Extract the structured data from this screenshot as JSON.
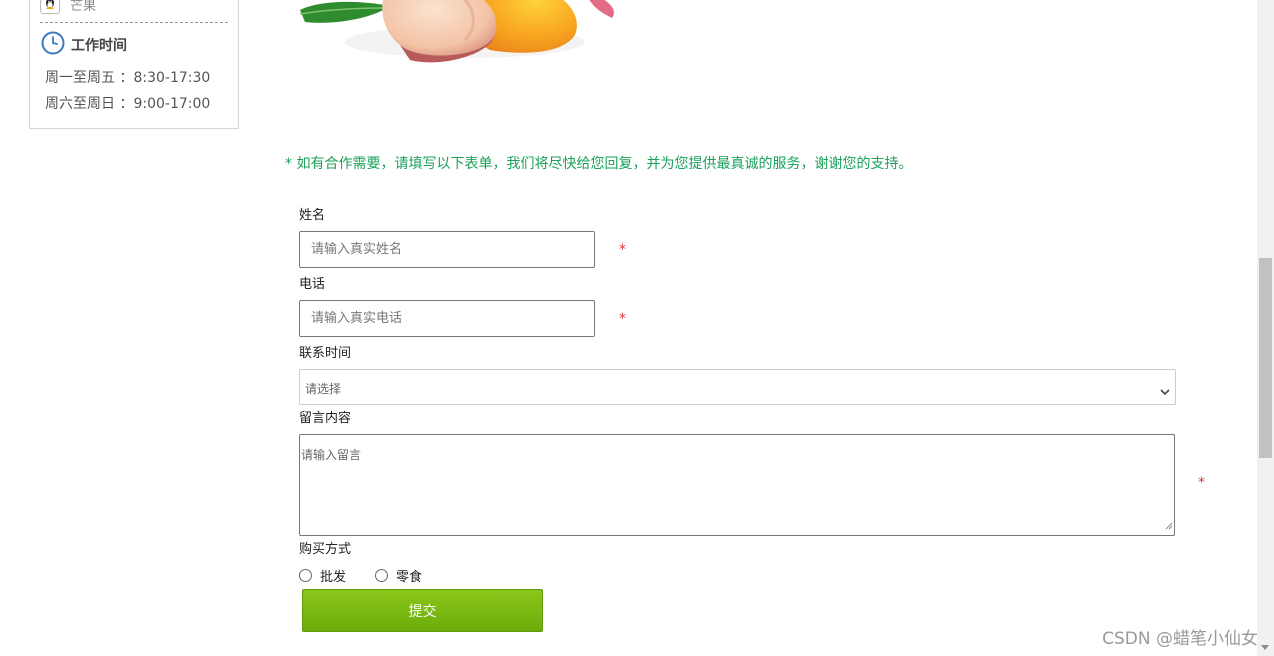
{
  "sidebar": {
    "qq_label": "芒果",
    "work_time_title": "工作时间",
    "weekday_hours": "周一至周五 ：8:30-17:30",
    "weekend_hours": "周六至周日 ：9:00-17:00"
  },
  "form": {
    "intro": "* 如有合作需要，请填写以下表单，我们将尽快给您回复，并为您提供最真诚的服务，谢谢您的支持。",
    "name_label": "姓名",
    "name_placeholder": "请输入真实姓名",
    "phone_label": "电话",
    "phone_placeholder": "请输入真实电话",
    "required_mark": "*",
    "contact_time_label": "联系时间",
    "contact_time_value": "请选择",
    "message_label": "留言内容",
    "message_placeholder": "请输入留言",
    "purchase_label": "购买方式",
    "purchase_options": [
      "批发",
      "零食"
    ],
    "submit_label": "提交"
  },
  "colors": {
    "intro_green": "#1aa15a",
    "required_red": "#e03a3a",
    "button_green": "#7ab812"
  },
  "watermark": "CSDN @蜡笔小仙女"
}
